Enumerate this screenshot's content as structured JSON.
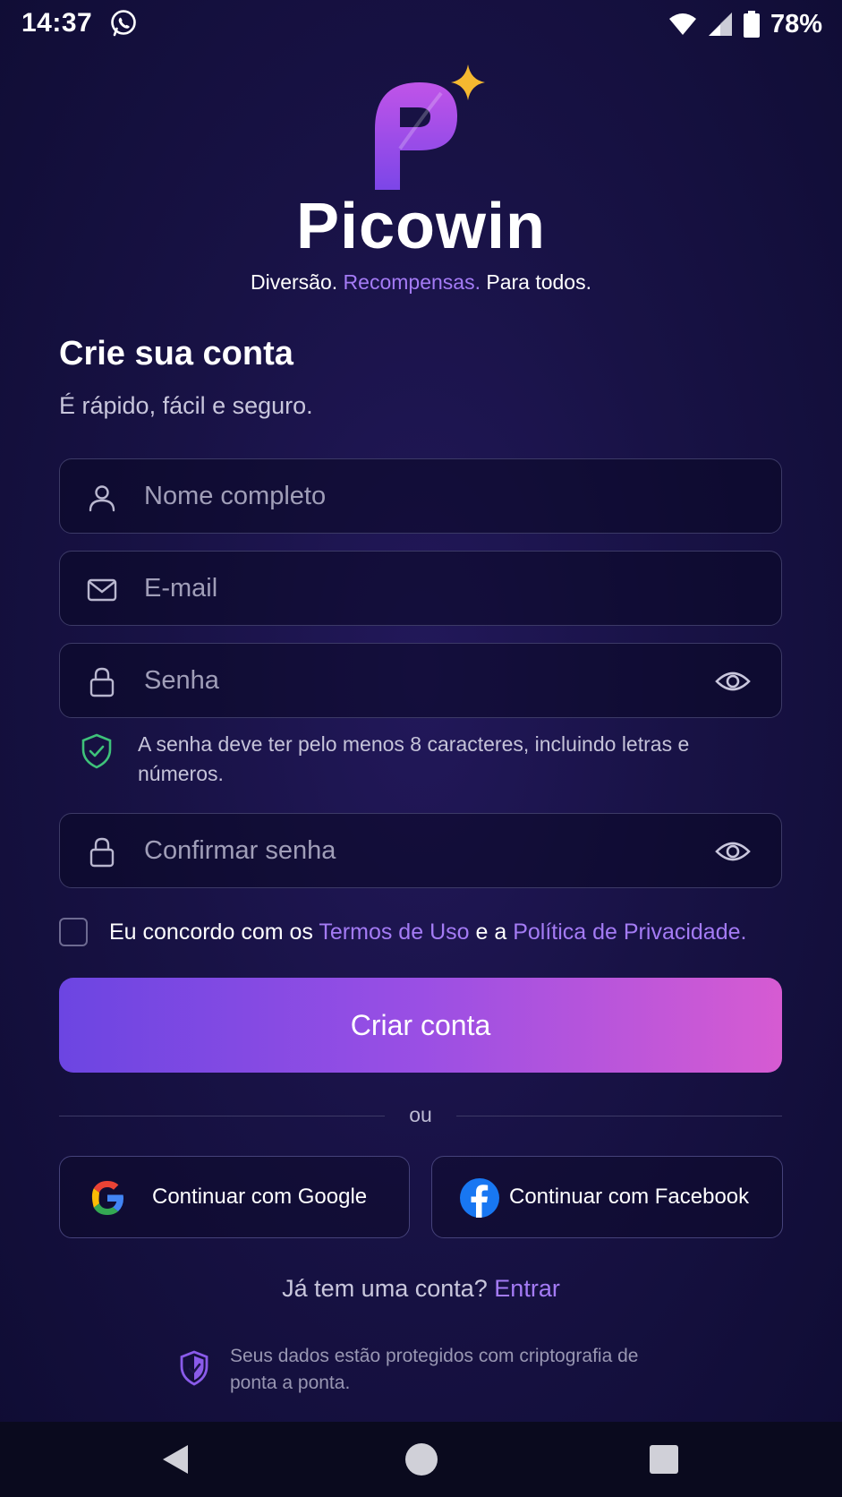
{
  "status_bar": {
    "time": "14:37",
    "battery": "78%"
  },
  "brand": {
    "name": "Picowin",
    "tagline": {
      "part1": "Diversão.",
      "part2": "Recompensas.",
      "part3": "Para todos."
    }
  },
  "form": {
    "title": "Crie sua conta",
    "subtitle": "É rápido, fácil e seguro.",
    "name_placeholder": "Nome completo",
    "email_placeholder": "E-mail",
    "password_placeholder": "Senha",
    "password_hint": "A senha deve ter pelo menos 8 caracteres, incluindo letras e números.",
    "confirm_placeholder": "Confirmar senha",
    "terms": {
      "prefix": "Eu concordo com os",
      "terms_link": "Termos de Uso",
      "middle": "e a",
      "privacy_link": "Política de Privacidade."
    },
    "submit_label": "Criar conta"
  },
  "divider_label": "ou",
  "social": {
    "google_label": "Continuar com Google",
    "facebook_label": "Continuar com Facebook"
  },
  "login": {
    "question": "Já tem uma conta?",
    "link": "Entrar"
  },
  "security_note": "Seus dados estão protegidos com criptografia de ponta a ponta.",
  "colors": {
    "accent": "#a47bf5",
    "gradient_start": "#6c45e2",
    "gradient_end": "#d65bd2",
    "background": "#181245",
    "hint_shield": "#3ec27a"
  }
}
